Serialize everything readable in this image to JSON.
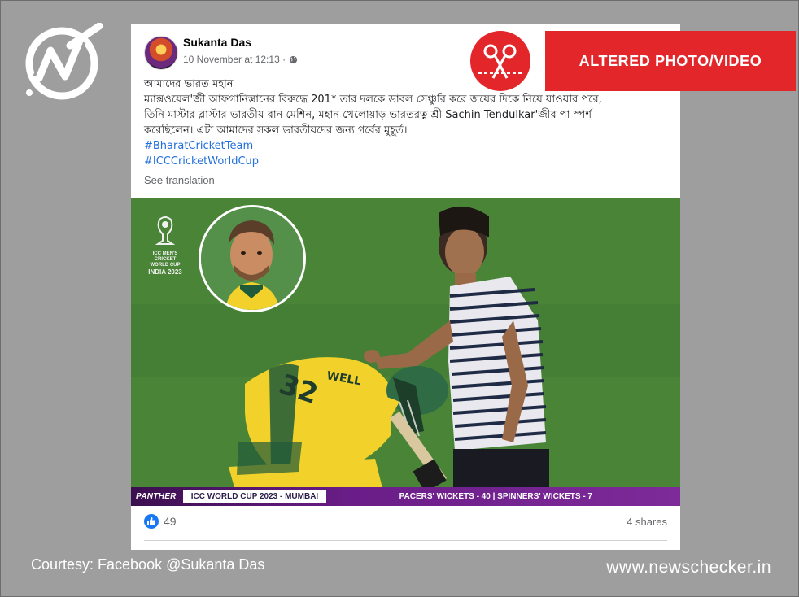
{
  "post": {
    "author": "Sukanta Das",
    "timestamp": "10 November at 12:13 ·",
    "privacy_icon": "globe-icon",
    "text_lines": [
      "আমাদের ভারত মহান",
      "ম্যাক্সওয়েল'জী আফগানিস্তানের বিরুদ্ধে 201* তার দলকে ডাবল সেঞ্চুরি করে জয়ের দিকে নিয়ে যাওয়ার পরে,",
      "তিনি মাস্টার ব্লাস্টার ভারতীয় রান মেশিন, মহান খেলোয়াড় ভারতরত্ন শ্রী Sachin Tendulkar'জীর পা স্পর্শ",
      "করেছিলেন। এটা আমাদের সকল ভারতীয়দের জন্য গর্বের মুহূর্ত।"
    ],
    "hashtags": [
      "#BharatCricketTeam",
      "#ICCCricketWorldCup"
    ],
    "see_translation": "See translation",
    "like_count": "49",
    "shares": "4 shares"
  },
  "photo": {
    "wc_logo_lines": [
      "ICC MEN'S",
      "CRICKET",
      "WORLD CUP",
      "INDIA 2023"
    ],
    "bar_brand": "PANTHER",
    "bar_title": "ICC WORLD CUP 2023 - MUMBAI",
    "bar_stats": "PACERS' WICKETS - 40 | SPINNERS' WICKETS - 7",
    "jersey_number": "32",
    "jersey_name": "WELL"
  },
  "badge": {
    "label": "ALTERED PHOTO/VIDEO",
    "icon": "scissors-icon"
  },
  "footer": {
    "courtesy": "Courtesy: Facebook @Sukanta Das",
    "website": "www.newschecker.in"
  },
  "colors": {
    "background": "#9e9e9e",
    "alert_red": "#e3262a",
    "hashtag_blue": "#216fdb",
    "facebook_blue": "#1877f2"
  }
}
